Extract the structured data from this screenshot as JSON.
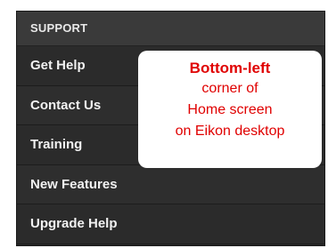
{
  "menu": {
    "header": "SUPPORT",
    "items": [
      {
        "label": "Get Help"
      },
      {
        "label": "Contact Us"
      },
      {
        "label": "Training"
      },
      {
        "label": "New Features"
      },
      {
        "label": "Upgrade Help"
      }
    ]
  },
  "callout": {
    "title": "Bottom-left",
    "lines": [
      "corner of",
      "Home screen",
      "on Eikon desktop"
    ]
  },
  "colors": {
    "menu_bg": "#2a2a2a",
    "header_bg": "#3a3a3a",
    "text": "#f2f2f2",
    "callout_text": "#e00000",
    "callout_bg": "#ffffff"
  }
}
